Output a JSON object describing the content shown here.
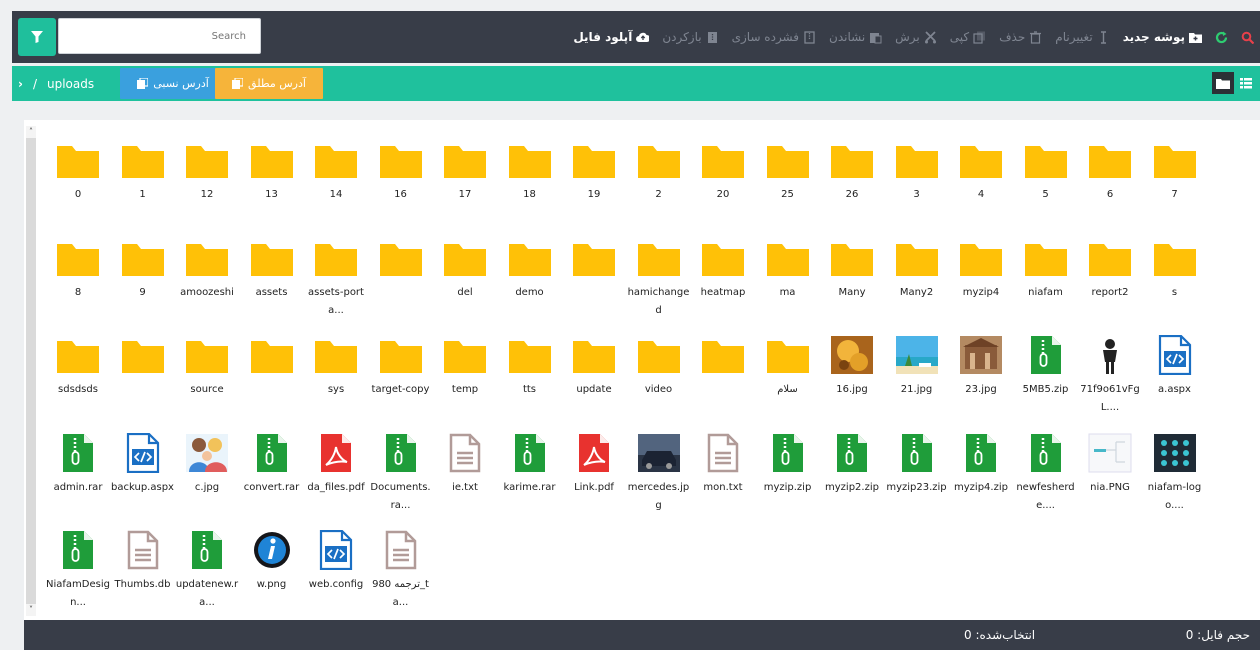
{
  "toolbar": {
    "search_placeholder": "Search",
    "actions": [
      {
        "id": "search",
        "label": "",
        "icon": "search-icon",
        "color": "#e8404a",
        "enabled": true
      },
      {
        "id": "refresh",
        "label": "",
        "icon": "refresh-icon",
        "color": "#2ecc71",
        "enabled": true
      },
      {
        "id": "new-folder",
        "label": "پوشه جدید",
        "icon": "new-folder-icon",
        "color": "#ffffff",
        "enabled": true
      },
      {
        "id": "rename",
        "label": "تغییرنام",
        "icon": "rename-icon",
        "color": "#7f8591",
        "enabled": false
      },
      {
        "id": "delete",
        "label": "حذف",
        "icon": "trash-icon",
        "color": "#7f8591",
        "enabled": false
      },
      {
        "id": "copy",
        "label": "کپی",
        "icon": "copy-icon",
        "color": "#7f8591",
        "enabled": false
      },
      {
        "id": "cut",
        "label": "برش",
        "icon": "cut-icon",
        "color": "#7f8591",
        "enabled": false
      },
      {
        "id": "paste",
        "label": "نشاندن",
        "icon": "paste-icon",
        "color": "#7f8591",
        "enabled": false
      },
      {
        "id": "compress",
        "label": "فشرده سازی",
        "icon": "compress-icon",
        "color": "#7f8591",
        "enabled": false
      },
      {
        "id": "extract",
        "label": "بازکردن",
        "icon": "extract-icon",
        "color": "#7f8591",
        "enabled": false
      },
      {
        "id": "upload",
        "label": "آپلود فایل",
        "icon": "upload-icon",
        "color": "#ffffff",
        "enabled": true
      }
    ]
  },
  "pathbar": {
    "separator": "/",
    "folder": "uploads",
    "relative_label": "آدرس نسبی",
    "absolute_label": "آدرس مطلق"
  },
  "colors": {
    "toolbar_bg": "#383d48",
    "accent": "#1fc19d",
    "folder": "#ffc107",
    "zip": "#1f9d3a",
    "pdf": "#e8322f",
    "code": "#1a6fc4",
    "text_file": "#b19b98"
  },
  "files": [
    {
      "name": "0",
      "type": "folder"
    },
    {
      "name": "1",
      "type": "folder"
    },
    {
      "name": "12",
      "type": "folder"
    },
    {
      "name": "13",
      "type": "folder"
    },
    {
      "name": "14",
      "type": "folder"
    },
    {
      "name": "16",
      "type": "folder"
    },
    {
      "name": "17",
      "type": "folder"
    },
    {
      "name": "18",
      "type": "folder"
    },
    {
      "name": "19",
      "type": "folder"
    },
    {
      "name": "2",
      "type": "folder"
    },
    {
      "name": "20",
      "type": "folder"
    },
    {
      "name": "25",
      "type": "folder"
    },
    {
      "name": "26",
      "type": "folder"
    },
    {
      "name": "3",
      "type": "folder"
    },
    {
      "name": "4",
      "type": "folder"
    },
    {
      "name": "5",
      "type": "folder"
    },
    {
      "name": "6",
      "type": "folder"
    },
    {
      "name": "7",
      "type": "folder"
    },
    {
      "name": "8",
      "type": "folder"
    },
    {
      "name": "9",
      "type": "folder"
    },
    {
      "name": "amoozeshi",
      "type": "folder"
    },
    {
      "name": "assets",
      "type": "folder"
    },
    {
      "name": "assets-porta...",
      "type": "folder"
    },
    {
      "name": "",
      "type": "folder"
    },
    {
      "name": "del",
      "type": "folder"
    },
    {
      "name": "demo",
      "type": "folder"
    },
    {
      "name": "",
      "type": "folder"
    },
    {
      "name": "hamichanged",
      "type": "folder"
    },
    {
      "name": "heatmap",
      "type": "folder"
    },
    {
      "name": "ma",
      "type": "folder"
    },
    {
      "name": "Many",
      "type": "folder"
    },
    {
      "name": "Many2",
      "type": "folder"
    },
    {
      "name": "myzip4",
      "type": "folder"
    },
    {
      "name": "niafam",
      "type": "folder"
    },
    {
      "name": "report2",
      "type": "folder"
    },
    {
      "name": "s",
      "type": "folder"
    },
    {
      "name": "sdsdsds",
      "type": "folder"
    },
    {
      "name": "",
      "type": "folder"
    },
    {
      "name": "source",
      "type": "folder"
    },
    {
      "name": "",
      "type": "folder"
    },
    {
      "name": "sys",
      "type": "folder"
    },
    {
      "name": "target-copy",
      "type": "folder"
    },
    {
      "name": "temp",
      "type": "folder"
    },
    {
      "name": "tts",
      "type": "folder"
    },
    {
      "name": "update",
      "type": "folder"
    },
    {
      "name": "video",
      "type": "folder"
    },
    {
      "name": "",
      "type": "folder"
    },
    {
      "name": "سلام",
      "type": "folder"
    },
    {
      "name": "16.jpg",
      "type": "image",
      "thumb": "drink"
    },
    {
      "name": "21.jpg",
      "type": "image",
      "thumb": "beach"
    },
    {
      "name": "23.jpg",
      "type": "image",
      "thumb": "building"
    },
    {
      "name": "5MB5.zip",
      "type": "zip"
    },
    {
      "name": "71f9o61vFgL....",
      "type": "image",
      "thumb": "figure"
    },
    {
      "name": "a.aspx",
      "type": "code"
    },
    {
      "name": "admin.rar",
      "type": "zip"
    },
    {
      "name": "backup.aspx",
      "type": "code"
    },
    {
      "name": "c.jpg",
      "type": "image",
      "thumb": "family"
    },
    {
      "name": "convert.rar",
      "type": "zip"
    },
    {
      "name": "da_files.pdf",
      "type": "pdf"
    },
    {
      "name": "Documents.ra...",
      "type": "zip"
    },
    {
      "name": "ie.txt",
      "type": "text"
    },
    {
      "name": "karime.rar",
      "type": "zip"
    },
    {
      "name": "Link.pdf",
      "type": "pdf"
    },
    {
      "name": "mercedes.jpg",
      "type": "image",
      "thumb": "car"
    },
    {
      "name": "mon.txt",
      "type": "text"
    },
    {
      "name": "myzip.zip",
      "type": "zip"
    },
    {
      "name": "myzip2.zip",
      "type": "zip"
    },
    {
      "name": "myzip23.zip",
      "type": "zip"
    },
    {
      "name": "myzip4.zip",
      "type": "zip"
    },
    {
      "name": "newfesherde....",
      "type": "zip"
    },
    {
      "name": "nia.PNG",
      "type": "image",
      "thumb": "diagram"
    },
    {
      "name": "niafam-logo....",
      "type": "image",
      "thumb": "logo"
    },
    {
      "name": "NiafamDesign...",
      "type": "zip"
    },
    {
      "name": "Thumbs.db",
      "type": "text"
    },
    {
      "name": "updatenew.ra...",
      "type": "zip"
    },
    {
      "name": "w.png",
      "type": "image",
      "thumb": "info"
    },
    {
      "name": "web.config",
      "type": "code"
    },
    {
      "name": "ترجمه 980_ta...",
      "type": "text"
    }
  ],
  "footer": {
    "file_size_label": "حجم فایل: 0",
    "selected_label": "انتخاب‌شده: 0"
  }
}
